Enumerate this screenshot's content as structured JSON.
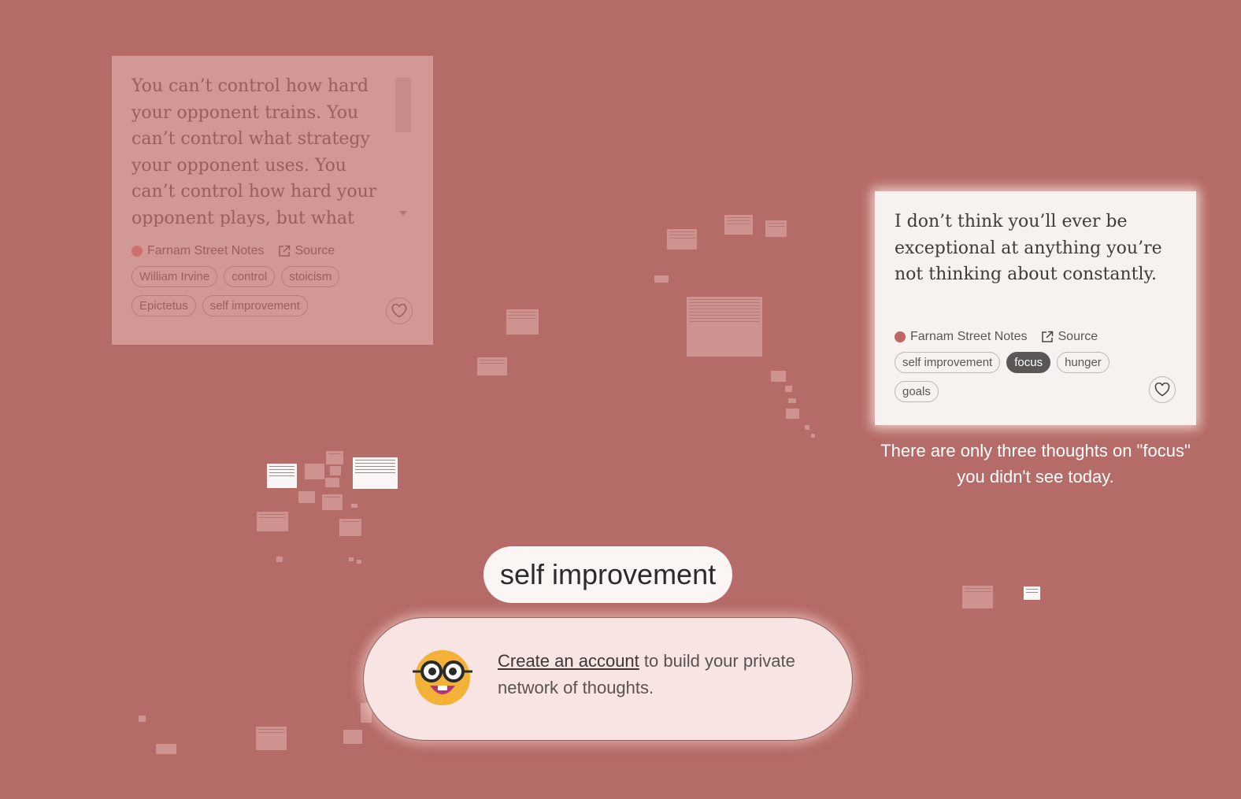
{
  "faded_card": {
    "quote": "You can’t control how hard your opponent trains. You can’t control what strategy your opponent uses. You can’t control how hard your opponent plays, but what can you control?",
    "source_name": "Farnam Street Notes",
    "source_link": "Source",
    "tags": [
      "William Irvine",
      "control",
      "stoicism",
      "Epictetus",
      "self improvement"
    ]
  },
  "active_card": {
    "quote": "I don’t think you’ll ever be exceptional at anything you’re not thinking about constantly.",
    "source_name": "Farnam Street Notes",
    "source_link": "Source",
    "tags": [
      "self improvement",
      "focus",
      "hunger",
      "goals"
    ],
    "selected_tag": "focus"
  },
  "notice": "There are only three thoughts on \"focus\" you didn't see today.",
  "topic": "self improvement",
  "signup": {
    "link_text": "Create an account",
    "rest_text": " to build your private network of thoughts."
  },
  "colors": {
    "background": "#b56b67",
    "source_dot": "#c06765",
    "selected_tag": "#5a5757",
    "mascot_face": "#f3b137"
  },
  "icons": [
    "external-link-icon",
    "heart-icon",
    "nerd-face-icon"
  ]
}
